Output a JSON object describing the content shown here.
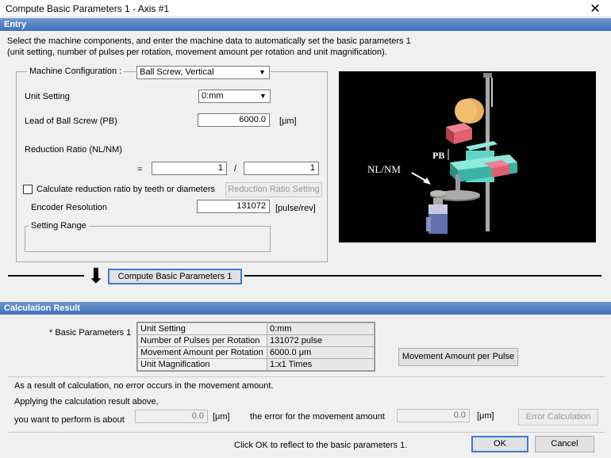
{
  "window": {
    "title": "Compute Basic Parameters 1 - Axis #1",
    "close_icon": "✕"
  },
  "entry": {
    "header": "Entry",
    "description_line1": "Select the machine components, and enter the machine data to automatically set the basic parameters 1",
    "description_line2": "(unit setting, number of pulses per rotation, movement amount per rotation and unit magnification).",
    "machine_config_label": "Machine Configuration :",
    "machine_config_value": "Ball Screw, Vertical",
    "unit_setting_label": "Unit Setting",
    "unit_setting_value": "0:mm",
    "lead_label": "Lead of Ball Screw (PB)",
    "lead_value": "6000.0",
    "lead_unit": "[μm]",
    "reduction_label": "Reduction Ratio (NL/NM)",
    "equals": "=",
    "ratio_numerator": "1",
    "ratio_slash": "/",
    "ratio_denominator": "1",
    "calc_checkbox_label": "Calculate reduction ratio by teeth or diameters",
    "calc_checkbox_checked": false,
    "reduction_setting_button": "Reduction Ratio Setting",
    "encoder_label": "Encoder Resolution",
    "encoder_value": "131072",
    "encoder_unit": "[pulse/rev]",
    "setting_range_label": "Setting Range",
    "image": {
      "pb_label": "PB",
      "nlnm_label": "NL/NM"
    }
  },
  "compute_button": "Compute Basic Parameters 1",
  "down_arrow_icon": "⬇",
  "result": {
    "header": "Calculation Result",
    "basic_params_label": "* Basic Parameters 1",
    "rows": [
      {
        "name": "Unit Setting",
        "value": "0:mm"
      },
      {
        "name": "Number of Pulses per Rotation",
        "value": "131072 pulse"
      },
      {
        "name": "Movement Amount per Rotation",
        "value": "6000.0 μm"
      },
      {
        "name": "Unit Magnification",
        "value": "1:x1 Times"
      }
    ],
    "movement_per_pulse_button": "Movement Amount per Pulse",
    "message1": "As a result of calculation, no error occurs in the movement amount.",
    "message2": "Applying the calculation result above,",
    "perform_label": "you want to perform is about",
    "perform_value": "0.0",
    "perform_unit": "[μm]",
    "error_label": "the error for the movement amount",
    "error_value": "0.0",
    "error_unit": "[μm]",
    "error_calc_button": "Error Calculation"
  },
  "footer": {
    "message": "Click OK to reflect to the basic parameters 1.",
    "ok_button": "OK",
    "cancel_button": "Cancel"
  },
  "colors": {
    "header_blue": "#4a7bc2",
    "image_bg": "#000000",
    "machine_teal": "#5ed6c6",
    "block_red": "#e06070",
    "pulley_gold": "#e8b060"
  }
}
